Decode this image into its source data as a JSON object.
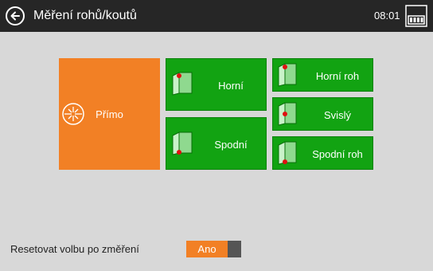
{
  "header": {
    "title": "Měření rohů/koutů",
    "time": "08:01"
  },
  "tiles": {
    "direct": "Přímo",
    "top": "Horní",
    "bottom": "Spodní",
    "top_corner": "Horní roh",
    "vertical": "Svislý",
    "bottom_corner": "Spodní roh"
  },
  "settings": {
    "reset_label": "Resetovat volbu po změření",
    "reset_value": "Ano"
  },
  "colors": {
    "accent": "#f28025",
    "tile_green": "#12a312",
    "background": "#d8d8d8",
    "titlebar": "#262626"
  }
}
